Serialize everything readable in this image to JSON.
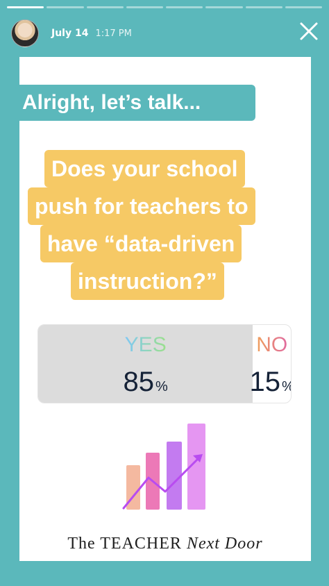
{
  "story": {
    "segments": 8,
    "active_segment": 1,
    "date": "July 14",
    "time": "1:17 PM"
  },
  "intro_tag": "Alright, let’s talk...",
  "question_lines": [
    "Does your school",
    "push for teachers to",
    "have “data-driven",
    "instruction?”"
  ],
  "poll": {
    "options": [
      {
        "label": "YES",
        "value": "85",
        "sign": "%"
      },
      {
        "label": "NO",
        "value": "15",
        "sign": "%"
      }
    ],
    "yes_fraction": 0.85
  },
  "brand": {
    "part1": "The TEACHER",
    "part2": "Next Door"
  },
  "colors": {
    "teal": "#5bb8bb",
    "yellow": "#f6c965",
    "yes_gradient": [
      "#7fc8f5",
      "#9be08a"
    ],
    "no_gradient": [
      "#f0a05a",
      "#e06aa0"
    ]
  },
  "icons": [
    "close-icon",
    "bar-chart-graphic"
  ]
}
